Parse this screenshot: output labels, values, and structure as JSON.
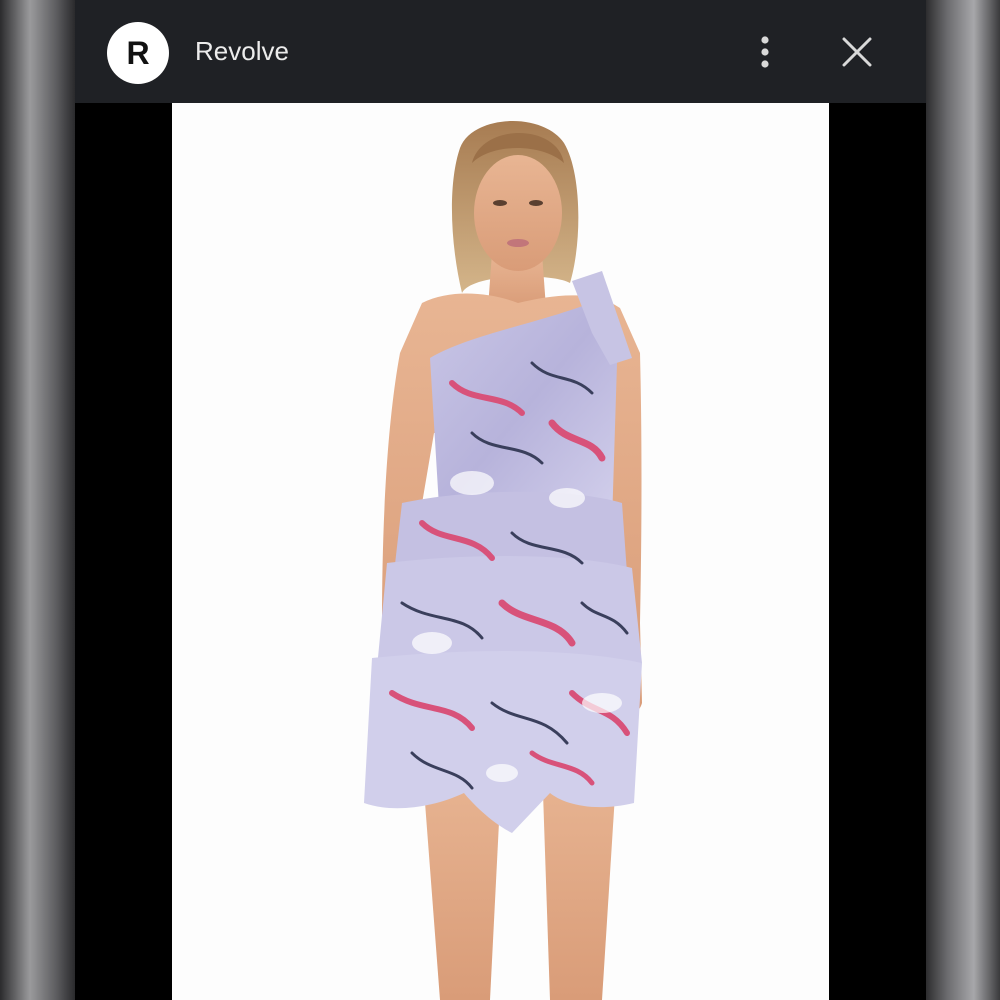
{
  "header": {
    "avatar_letter": "R",
    "site_name": "Revolve",
    "menu_icon": "vertical-dots-icon",
    "close_icon": "close-icon"
  },
  "image": {
    "subject": "model-wearing-floral-one-shoulder-ruffled-dress",
    "dress_colors": [
      "#b9b6dc",
      "#d8527a",
      "#ffffff",
      "#3a3f5c"
    ]
  },
  "colors": {
    "topbar_bg": "#1f2125",
    "viewer_bg": "#000000",
    "photo_bg": "#fdfdfd"
  }
}
